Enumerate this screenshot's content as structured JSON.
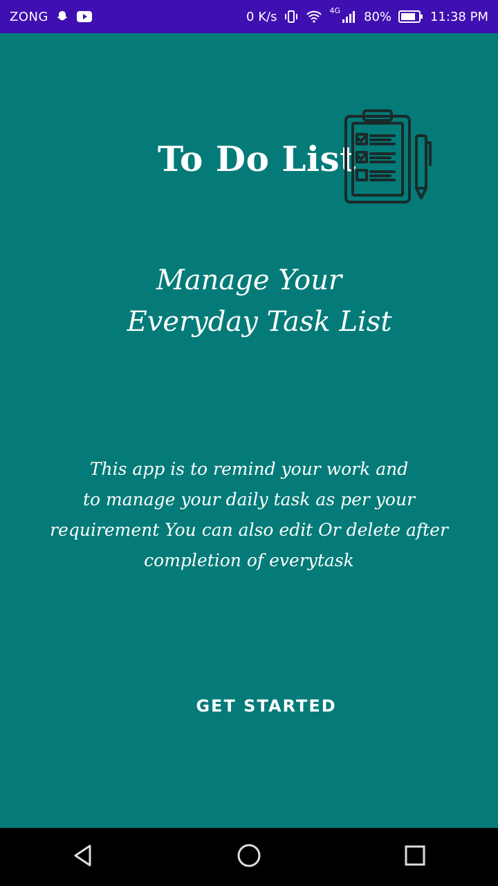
{
  "status_bar": {
    "carrier": "ZONG",
    "speed": "0 K/s",
    "network": "4G",
    "battery": "80%",
    "time": "11:38 PM",
    "icons": [
      "snapchat-icon",
      "youtube-icon",
      "vibrate-icon",
      "wifi-icon",
      "signal-icon",
      "battery-icon"
    ]
  },
  "app": {
    "title": "To Do List",
    "icon": "clipboard-checklist-icon",
    "tagline_line1": "Manage Your",
    "tagline_line2": "Everyday Task List",
    "description_lines": [
      "This app is to remind your work and",
      "to manage your daily task as per your",
      "requirement You can also edit Or delete after",
      "completion of everytask"
    ],
    "cta_label": "GET STARTED"
  },
  "nav_bar": {
    "icons": [
      "back-icon",
      "home-icon",
      "recents-icon"
    ]
  },
  "colors": {
    "background": "#047b78",
    "status_bar": "#3f0fb1",
    "nav_bar": "#000000",
    "text": "#ffffff",
    "icon_stroke": "#1a2a2a"
  }
}
